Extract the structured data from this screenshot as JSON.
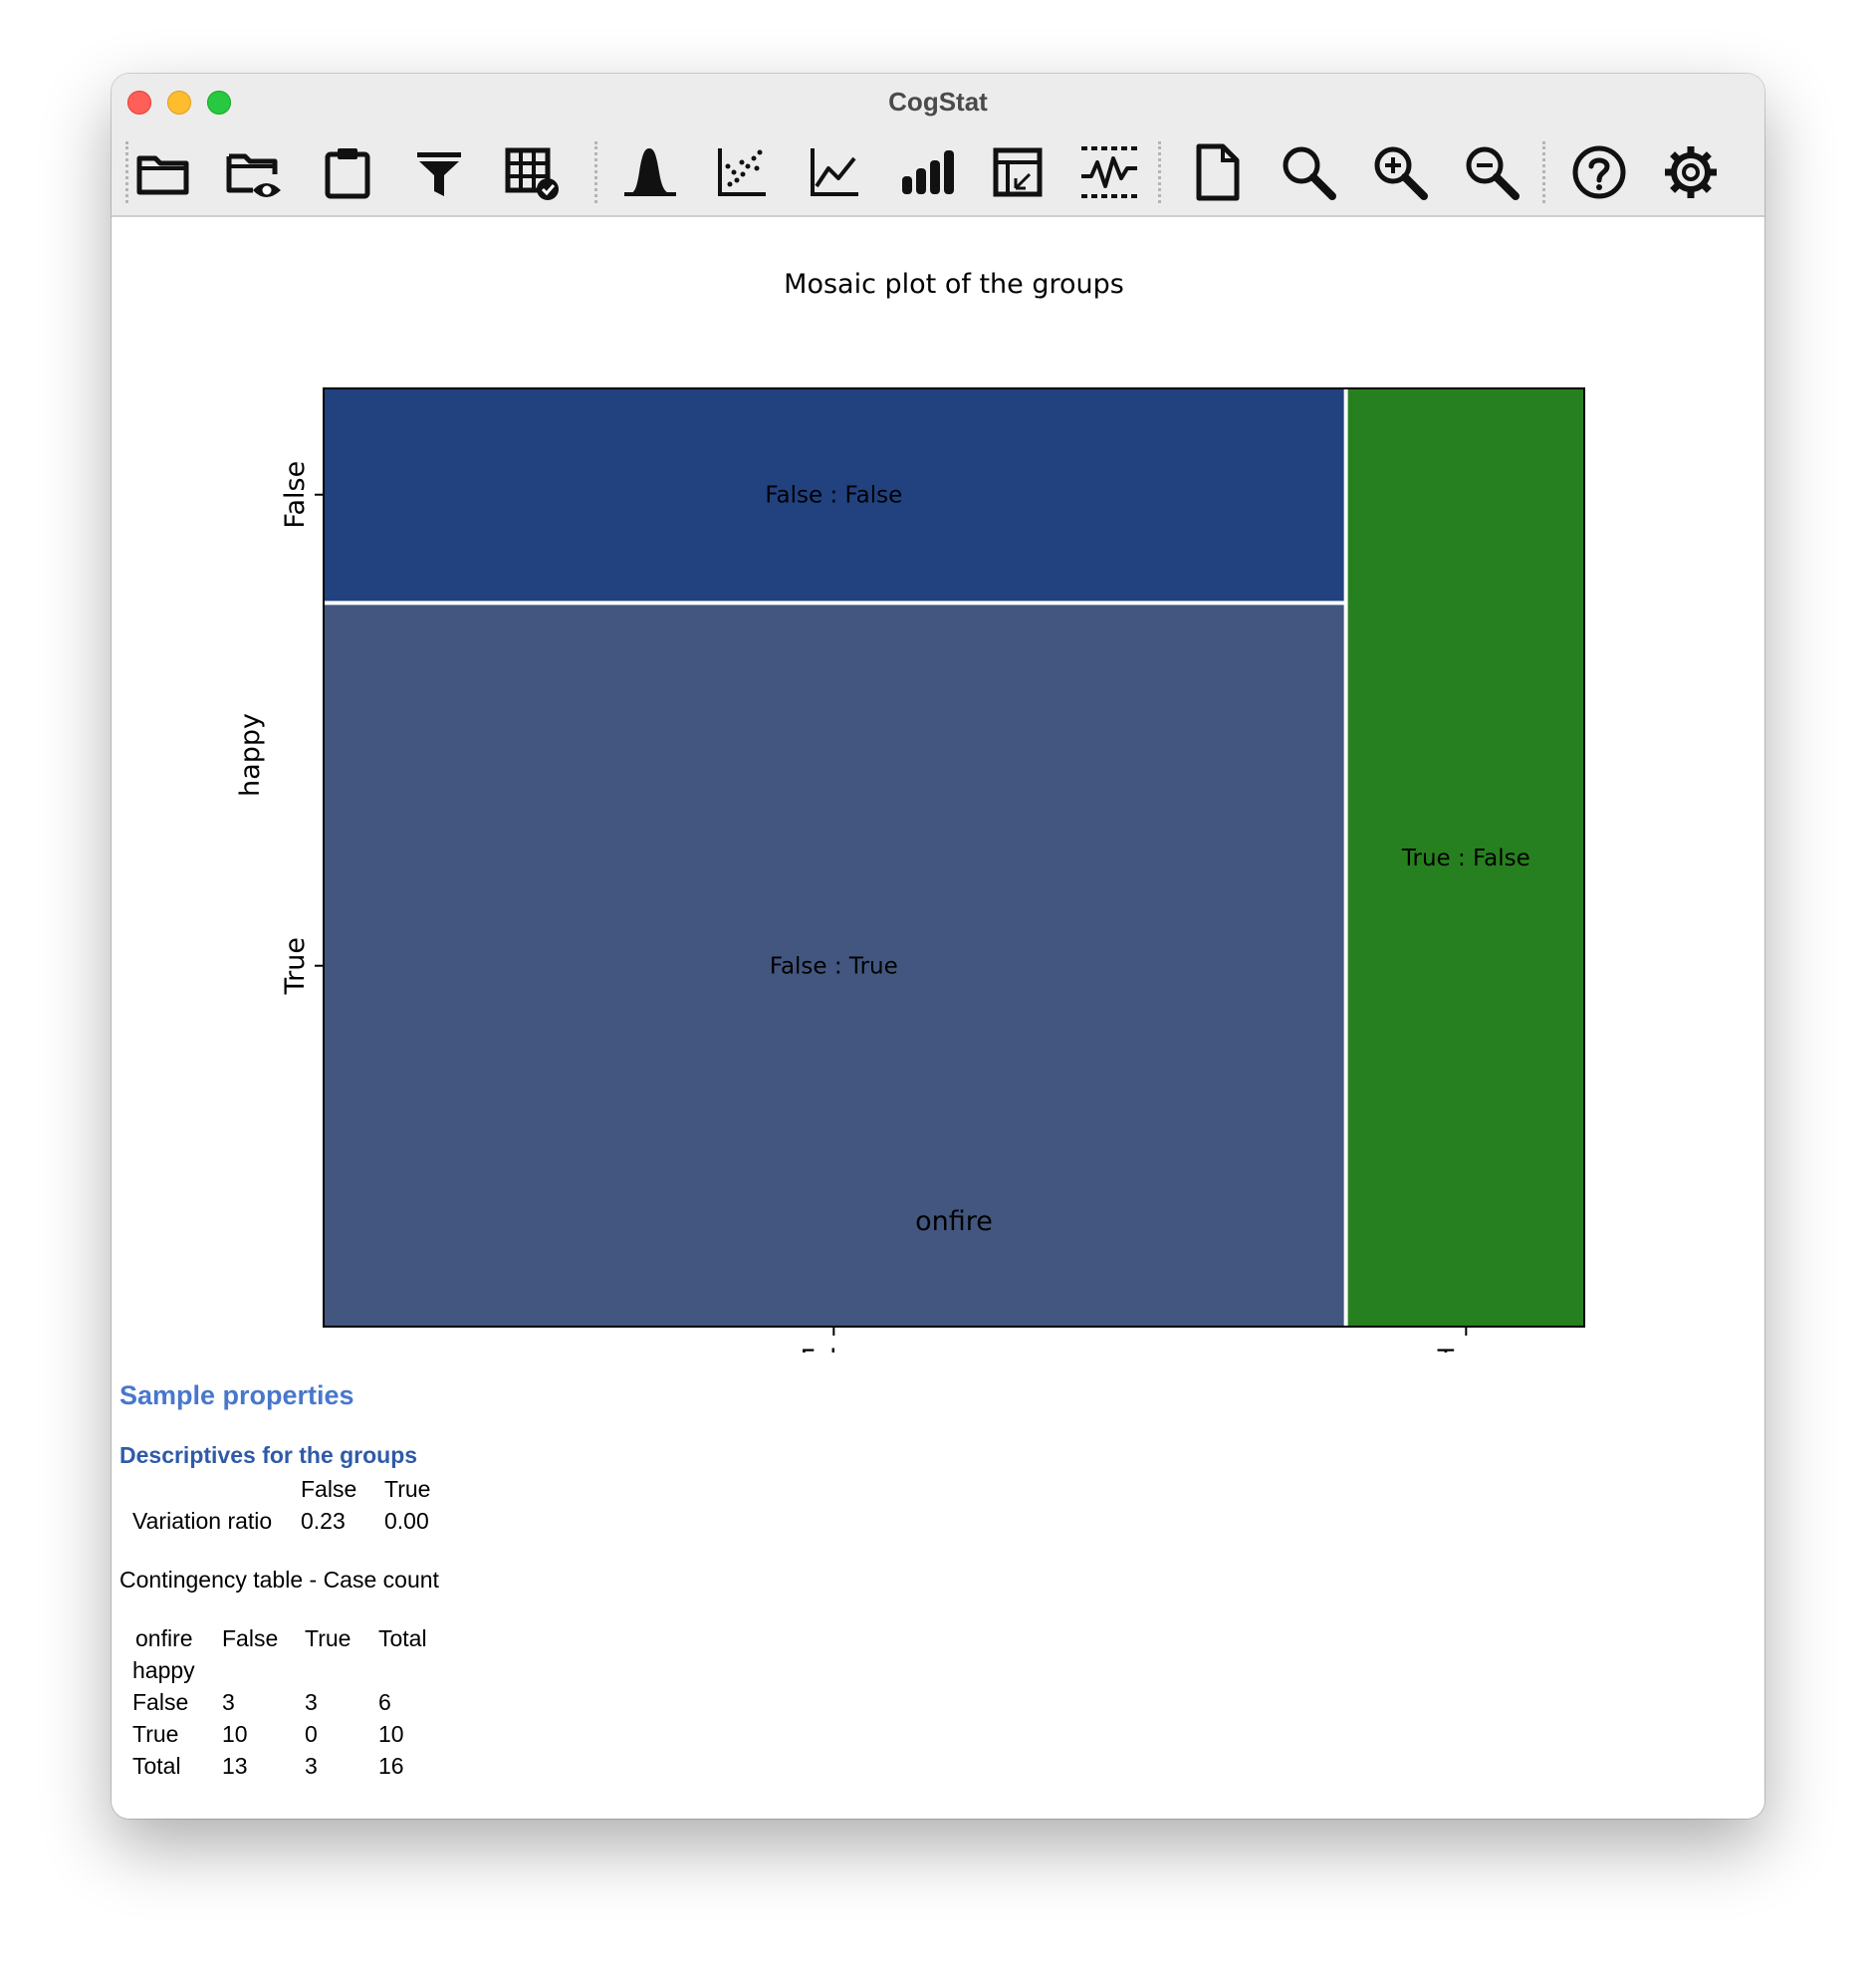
{
  "window": {
    "title": "CogStat"
  },
  "toolbar": {
    "icons": [
      "folder-icon",
      "folder-eye-icon",
      "clipboard-icon",
      "filter-icon",
      "data-check-icon",
      "distribution-icon",
      "scatter-icon",
      "line-chart-icon",
      "bar-chart-icon",
      "pivot-table-icon",
      "compare-icon",
      "new-document-icon",
      "search-icon",
      "zoom-in-icon",
      "zoom-out-icon",
      "help-icon",
      "gear-icon"
    ]
  },
  "chart_data": {
    "type": "mosaic",
    "title": "Mosaic plot of the groups",
    "xlabel": "onfire",
    "ylabel": "happy",
    "x_categories": [
      "False",
      "True"
    ],
    "y_categories": [
      "False",
      "True"
    ],
    "counts": [
      {
        "onfire": "False",
        "happy": "False",
        "count": 3,
        "label": "False : False",
        "color": "#21417f"
      },
      {
        "onfire": "False",
        "happy": "True",
        "count": 10,
        "label": "False : True",
        "color": "#42567f"
      },
      {
        "onfire": "True",
        "happy": "False",
        "count": 3,
        "label": "True : False",
        "color": "#27801f"
      },
      {
        "onfire": "True",
        "happy": "True",
        "count": 0,
        "label": "",
        "color": "#27801f"
      }
    ]
  },
  "results": {
    "section_title": "Sample properties",
    "desc_title": "Descriptives for the groups",
    "desc_table": {
      "headers": [
        "False",
        "True"
      ],
      "row_label": "Variation ratio",
      "values": [
        "0.23",
        "0.00"
      ]
    },
    "contingency_title": "Contingency table - Case count",
    "contingency": {
      "col_var": "onfire",
      "row_var": "happy",
      "headers": [
        "False",
        "True",
        "Total"
      ],
      "rows": [
        {
          "label": "False",
          "values": [
            "3",
            "3",
            "6"
          ]
        },
        {
          "label": "True",
          "values": [
            "10",
            "0",
            "10"
          ]
        },
        {
          "label": "Total",
          "values": [
            "13",
            "3",
            "16"
          ]
        }
      ]
    }
  }
}
